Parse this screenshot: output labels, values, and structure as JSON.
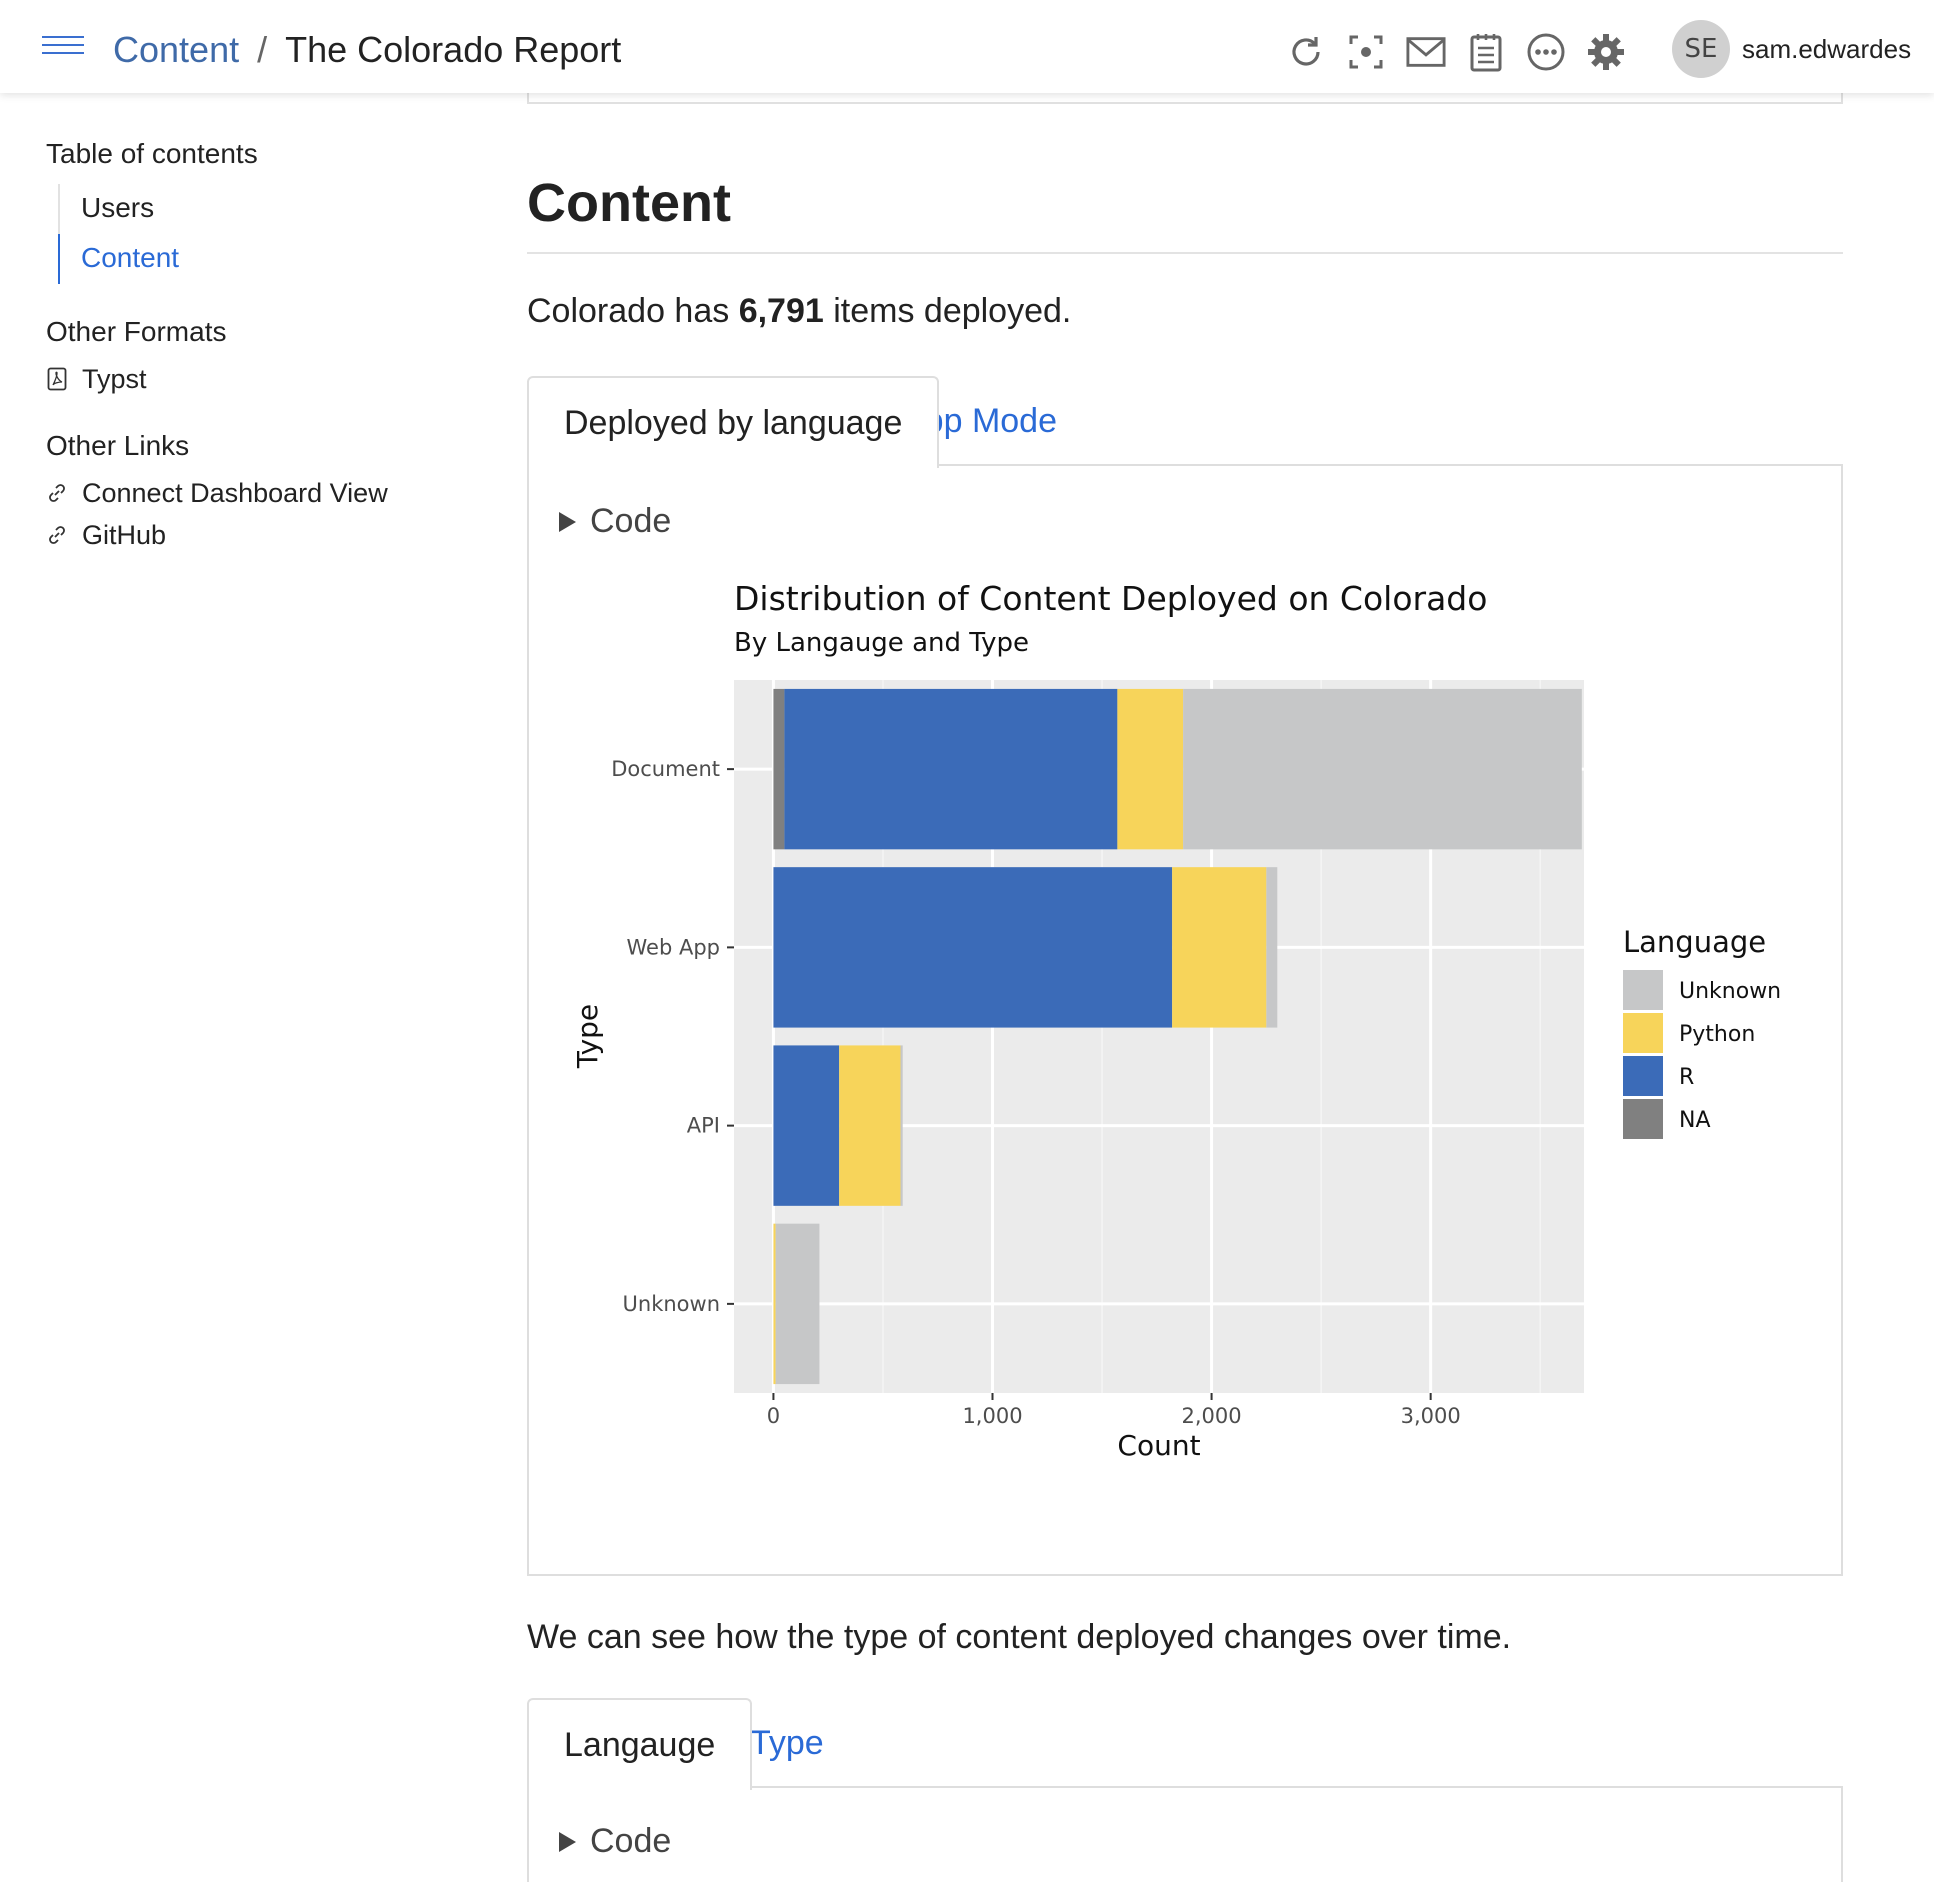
{
  "header": {
    "breadcrumb_root": "Content",
    "breadcrumb_sep": "/",
    "breadcrumb_current": "The Colorado Report",
    "icons": [
      "refresh-icon",
      "focus-icon",
      "mail-icon",
      "notes-icon",
      "more-icon",
      "gear-icon"
    ],
    "avatar_initials": "SE",
    "username": "sam.edwardes"
  },
  "sidebar": {
    "toc_heading": "Table of contents",
    "toc_items": [
      {
        "label": "Users",
        "active": false
      },
      {
        "label": "Content",
        "active": true
      }
    ],
    "formats_heading": "Other Formats",
    "formats": [
      {
        "label": "Typst",
        "icon": "pdf-file-icon"
      }
    ],
    "links_heading": "Other Links",
    "links": [
      {
        "label": "Connect Dashboard View",
        "icon": "link-icon"
      },
      {
        "label": "GitHub",
        "icon": "link-icon"
      }
    ]
  },
  "main": {
    "section_title": "Content",
    "summary_prefix": "Colorado has ",
    "summary_count": "6,791",
    "summary_suffix": " items deployed.",
    "tabs1": [
      {
        "label": "Deployed by language",
        "active": true
      },
      {
        "label": "App Mode",
        "active": false
      }
    ],
    "code_label": "Code",
    "between_text": "We can see how the type of content deployed changes over time.",
    "tabs2": [
      {
        "label": "Langauge",
        "active": true
      },
      {
        "label": "Type",
        "active": false
      }
    ]
  },
  "chart_data": {
    "type": "bar",
    "orientation": "horizontal",
    "stacked": true,
    "title": "Distribution of Content Deployed on Colorado",
    "subtitle": "By Langauge and Type",
    "xlabel": "Count",
    "ylabel": "Type",
    "categories": [
      "Document",
      "Web App",
      "API",
      "Unknown"
    ],
    "legend_title": "Language",
    "legend_position": "right",
    "xlim": [
      -180,
      3700
    ],
    "xticks": [
      0,
      1000,
      2000,
      3000
    ],
    "xtick_labels": [
      "0",
      "1,000",
      "2,000",
      "3,000"
    ],
    "grid": true,
    "series": [
      {
        "name": "NA",
        "color": "#808080",
        "values": [
          50,
          0,
          0,
          0
        ]
      },
      {
        "name": "R",
        "color": "#3b6bb8",
        "values": [
          1520,
          1820,
          300,
          0
        ]
      },
      {
        "name": "Python",
        "color": "#f7d45a",
        "values": [
          300,
          430,
          280,
          10
        ]
      },
      {
        "name": "Unknown",
        "color": "#c6c7c8",
        "values": [
          1820,
          50,
          10,
          200
        ]
      }
    ],
    "legend_order": [
      "Unknown",
      "Python",
      "R",
      "NA"
    ]
  }
}
